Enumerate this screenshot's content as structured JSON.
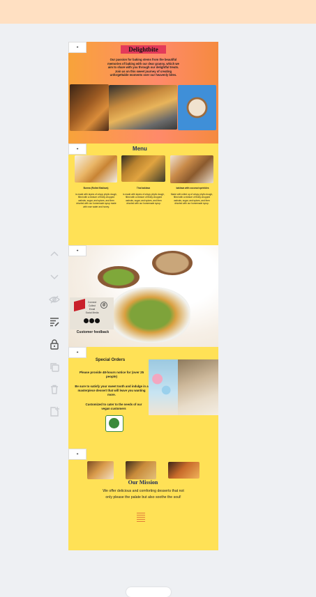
{
  "pages": {
    "p1": {
      "title": "Delightbite",
      "text": "Our passion for baking stems from the beautiful memories of baking with our dear granny, which we aim to share with you through our delightful treats. Join us on this sweet journey of creating unforgettable moments over our heavenly bites."
    },
    "p2": {
      "heading": "Menu",
      "items": [
        {
          "name": "Burma (Rolled Baklava)",
          "desc": "is made with layers of crispy phyllo dough, filled with a mixture of finely chopped walnuts, sugar, and spices, and then drizzled with our homemade syrup made with rose water and honey."
        },
        {
          "name": "Thai baklava",
          "desc": "is made with layers of crispy phyllo dough, filled with a mixture of finely chopped walnuts, sugar, and spices, and then drizzled with our homemade syrup."
        },
        {
          "name": "baklava with coconut sprinkles",
          "desc": "Made with rolled up of crispy phyllo dough, filled with a mixture of finely chopped walnuts, sugar, and spices, and then drizzled with our homemade syrup."
        }
      ]
    },
    "p3": {
      "qr_lines": [
        "Connect",
        "Collect",
        "Email",
        "Social Media"
      ],
      "feedback": "Customer feedback"
    },
    "p4": {
      "heading": "Special Orders",
      "notice": "Please provide 48-hours notice for (over 25 people)",
      "satisfy": "Be sure to satisfy your sweet tooth and indulge in a masterpiece dessert that will leave you wanting more.",
      "vegan": "Customized to cater to the needs of our vegan customers"
    },
    "p5": {
      "heading": "Our Mission",
      "text": "We offer delicious and comforting desserts that not only please the palate but also soothe the soul!"
    }
  },
  "colors": {
    "topbar": "#ffe0c2",
    "page_yellow": "#ffe156",
    "title_red": "#e33a5a",
    "navy": "#1c2a5a"
  },
  "tools": [
    "chevron-up-icon",
    "chevron-down-icon",
    "eye-off-icon",
    "notes-icon",
    "lock-icon",
    "duplicate-icon",
    "trash-icon",
    "add-page-icon"
  ]
}
